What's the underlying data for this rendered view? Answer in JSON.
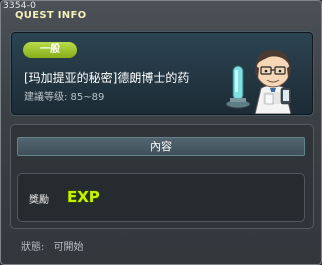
{
  "window": {
    "id_text": "3354-0",
    "title": "QUEST INFO"
  },
  "quest": {
    "category_badge": "一般",
    "name": "[玛加提亚的秘密]德朗博士的药",
    "level_range": "建議等级: 85~89"
  },
  "content_tab": {
    "label": "內容"
  },
  "reward": {
    "label": "獎勵",
    "exp_icon_text": "EXP"
  },
  "status": {
    "label": "狀態:",
    "value": "可開始"
  },
  "colors": {
    "title": "#f4f0b8",
    "badge": "#9ac532",
    "exp": "#c8f000"
  },
  "icons": [
    "npc-doctor-portrait",
    "exp-icon"
  ]
}
